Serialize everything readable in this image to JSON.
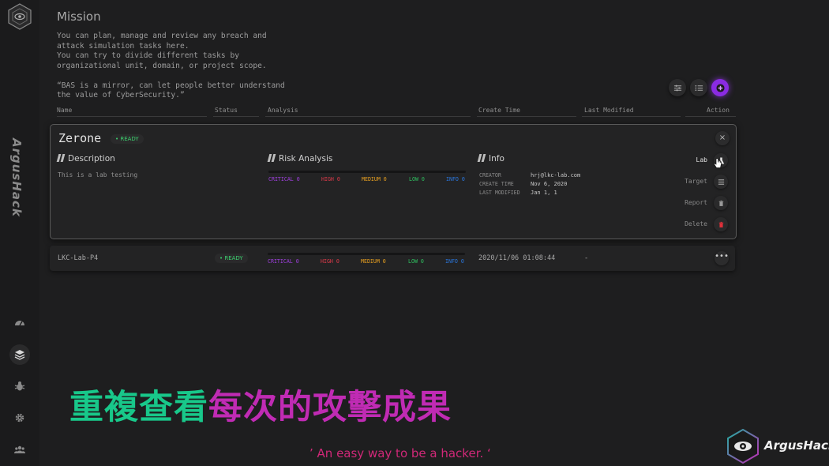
{
  "sidebar": {
    "brand": "ArgusHack",
    "items": [
      {
        "name": "dashboard-icon"
      },
      {
        "name": "layers-icon",
        "active": true
      },
      {
        "name": "bug-icon"
      },
      {
        "name": "gear-icon"
      },
      {
        "name": "users-icon"
      }
    ]
  },
  "page": {
    "title": "Mission",
    "description": "You can plan, manage and review any breach and\nattack simulation tasks here.\nYou can try to divide different tasks by\norganizational unit, domain, or project scope.\n\n“BAS is a mirror, can let people better understand\nthe value of CyberSecurity.”"
  },
  "toolbar": {
    "buttons": [
      "filter-icon",
      "list-icon",
      "add-icon"
    ],
    "add_color": "#8a2be2"
  },
  "table": {
    "columns": [
      "Name",
      "Status",
      "Analysis",
      "Create Time",
      "Last Modified",
      "Action"
    ]
  },
  "expanded": {
    "name": "Zerone",
    "status": "• READY",
    "close": "×",
    "description_title": "Description",
    "description_text": "This is a lab testing",
    "risk_title": "Risk Analysis",
    "risk": {
      "critical": "CRITICAL 0",
      "high": "HIGH 0",
      "medium": "MEDIUM 0",
      "low": "LOW 0",
      "info": "INFO 0"
    },
    "info_title": "Info",
    "info": {
      "creator_label": "CREATOR",
      "creator": "hrj@lkc-lab.com",
      "create_time_label": "CREATE TIME",
      "create_time": "Nov 6, 2020",
      "last_modified_label": "LAST MODIFIED",
      "last_modified": "Jan 1, 1"
    },
    "actions": {
      "lab": "Lab",
      "target": "Target",
      "report": "Report",
      "delete": "Delete"
    }
  },
  "rows": [
    {
      "name": "LKC-Lab-P4",
      "status": "• READY",
      "risk": {
        "critical": "CRITICAL 0",
        "high": "HIGH 0",
        "medium": "MEDIUM 0",
        "low": "LOW 0",
        "info": "INFO 0"
      },
      "create_time": "2020/11/06 01:08:44",
      "last_modified": "-",
      "more": "•••"
    }
  ],
  "colors": {
    "critical": "#a040e0",
    "high": "#e03a4a",
    "medium": "#e8a020",
    "low": "#2fc060",
    "info": "#2a78e0",
    "ready": "#3ccf6e"
  },
  "overlay": {
    "caption_part1": "重複查看",
    "caption_part2": "每次的攻擊成果",
    "tagline": "’ An easy way to be a hacker. ‘",
    "watermark": "ArgusHack"
  }
}
